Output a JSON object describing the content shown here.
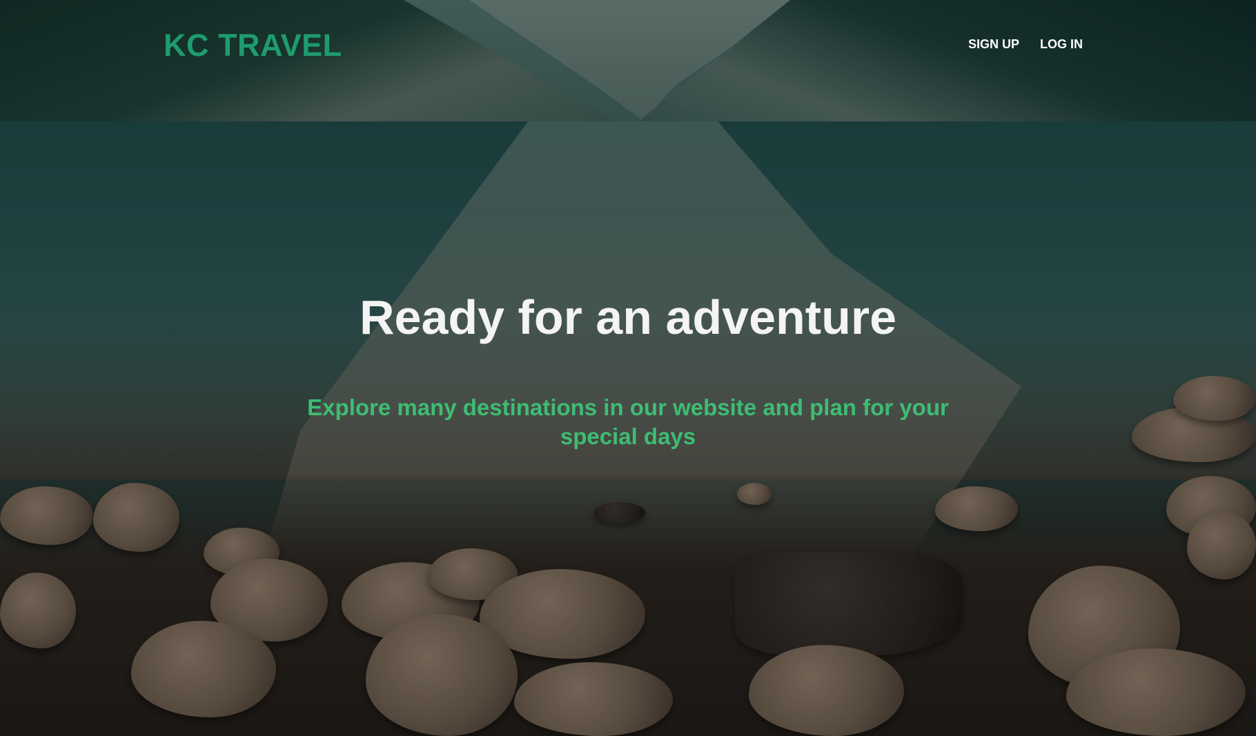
{
  "header": {
    "logo": "KC TRAVEL",
    "nav": [
      {
        "label": "SIGN UP"
      },
      {
        "label": "LOG IN"
      }
    ]
  },
  "hero": {
    "title": "Ready for an adventure",
    "subtitle": "Explore many destinations in our website and plan for your special days"
  },
  "colors": {
    "brand": "#1e9c6e",
    "subtitle": "#3ebd73",
    "title": "#f4f4f2",
    "nav": "#ffffff"
  }
}
